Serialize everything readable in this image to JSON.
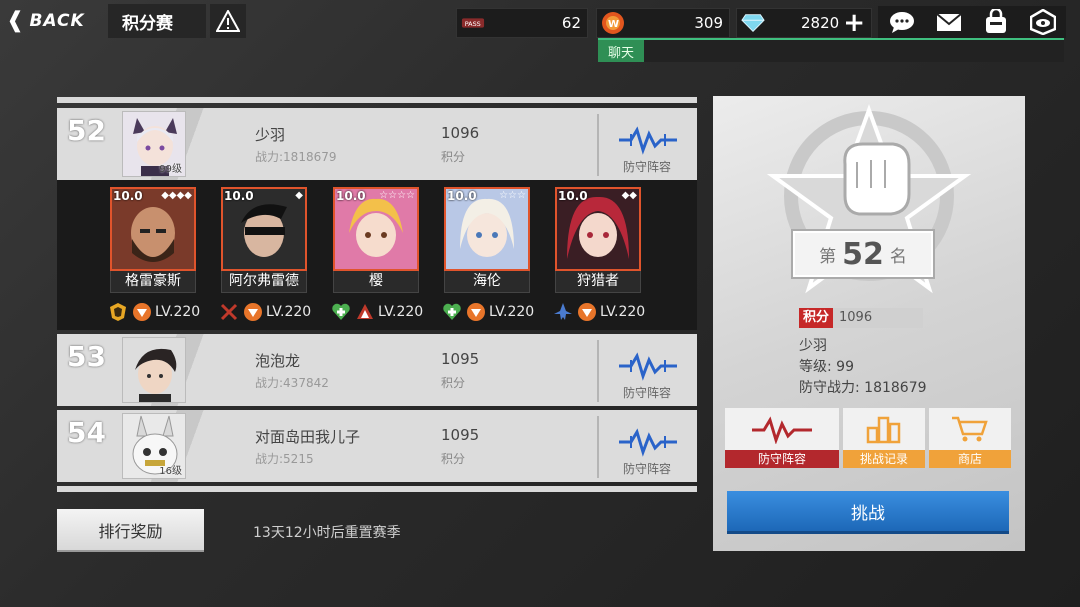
{
  "header": {
    "back_label": "BACK",
    "title": "积分赛"
  },
  "resources": [
    {
      "icon": "ticket-icon",
      "value": "62"
    },
    {
      "icon": "medal-icon",
      "value": "309"
    },
    {
      "icon": "diamond-icon",
      "value": "2820"
    }
  ],
  "chat": {
    "label": "聊天"
  },
  "rows": [
    {
      "rank": "52",
      "name": "少羽",
      "power": "战力:1818679",
      "score": "1096",
      "score_label": "积分",
      "level": "99级",
      "defense_label": "防守阵容"
    },
    {
      "rank": "53",
      "name": "泡泡龙",
      "power": "战力:437842",
      "score": "1095",
      "score_label": "积分",
      "level": "",
      "defense_label": "防守阵容"
    },
    {
      "rank": "54",
      "name": "对面岛田我儿子",
      "power": "战力:5215",
      "score": "1095",
      "score_label": "积分",
      "level": "16级",
      "defense_label": "防守阵容"
    }
  ],
  "heroes": [
    {
      "level": "10.0",
      "name": "格雷豪斯",
      "lv": "LV.220",
      "color": "#b83a2a"
    },
    {
      "level": "10.0",
      "name": "阿尔弗雷德",
      "lv": "LV.220",
      "color": "#3a3a3a"
    },
    {
      "level": "10.0",
      "name": "樱",
      "lv": "LV.220",
      "color": "#d9608f"
    },
    {
      "level": "10.0",
      "name": "海伦",
      "lv": "LV.220",
      "color": "#9fb3d9"
    },
    {
      "level": "10.0",
      "name": "狩猎者",
      "lv": "LV.220",
      "color": "#9a2230"
    }
  ],
  "footer": {
    "reward_label": "排行奖励",
    "reset_text": "13天12小时后重置赛季"
  },
  "panel": {
    "rank_prefix": "第",
    "rank": "52",
    "rank_suffix": "名",
    "score_badge": "积分",
    "score_value": "1096",
    "player_name": "少羽",
    "level_text": "等级:  99",
    "defense_power": "防守战力:  1818679",
    "actions": [
      {
        "label": "防守阵容",
        "color": "#b3282d"
      },
      {
        "label": "挑战记录",
        "color": "#f0a23a"
      },
      {
        "label": "商店",
        "color": "#f0a23a"
      }
    ],
    "challenge_label": "挑战"
  }
}
